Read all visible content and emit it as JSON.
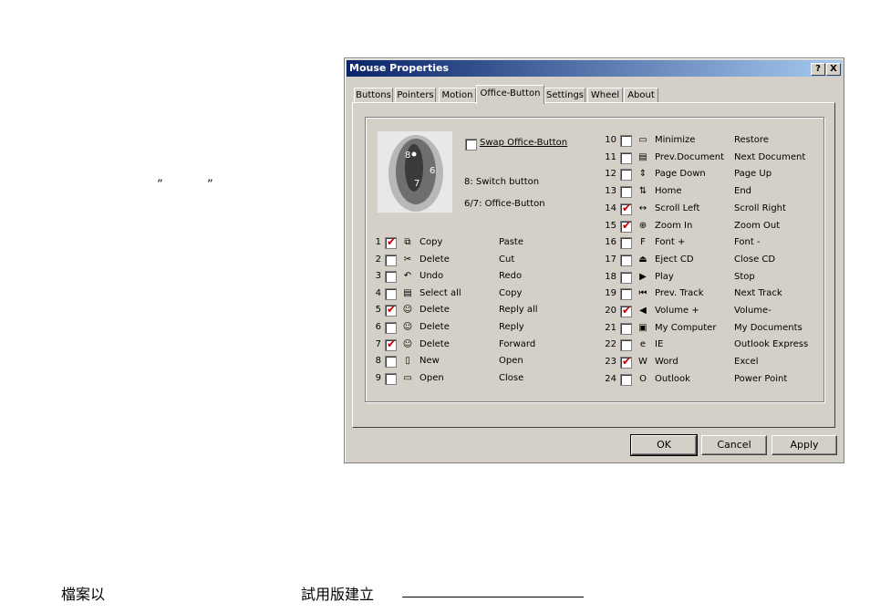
{
  "page": {
    "quote_open": "”",
    "quote_close": "”",
    "footer_left": "檔案以",
    "footer_right": "試用版建立"
  },
  "window": {
    "title": "Mouse Properties",
    "help_btn": "?",
    "close_btn": "X"
  },
  "tabs": [
    "Buttons",
    "Pointers",
    "Motion",
    "Office-Button",
    "Settings",
    "Wheel",
    "About"
  ],
  "swap_label": "Swap Office-Button",
  "info": [
    "8: Switch button",
    "6/7: Office-Button"
  ],
  "image_labels": [
    "8",
    "6",
    "7"
  ],
  "left_rows": [
    {
      "num": "1",
      "checked": true,
      "icon": "copy-icon",
      "glyph": "⧉",
      "action": "Copy",
      "alt": "Paste"
    },
    {
      "num": "2",
      "checked": false,
      "icon": "scissors-icon",
      "glyph": "✂",
      "action": "Delete",
      "alt": "Cut"
    },
    {
      "num": "3",
      "checked": false,
      "icon": "undo-icon",
      "glyph": "↶",
      "action": "Undo",
      "alt": "Redo"
    },
    {
      "num": "4",
      "checked": false,
      "icon": "select-all-icon",
      "glyph": "▤",
      "action": "Select all",
      "alt": "Copy"
    },
    {
      "num": "5",
      "checked": true,
      "icon": "mail-people-icon",
      "glyph": "☺",
      "action": "Delete",
      "alt": "Reply all"
    },
    {
      "num": "6",
      "checked": false,
      "icon": "mail-person-icon",
      "glyph": "☺",
      "action": "Delete",
      "alt": "Reply"
    },
    {
      "num": "7",
      "checked": true,
      "icon": "mail-forward-icon",
      "glyph": "☺",
      "action": "Delete",
      "alt": "Forward"
    },
    {
      "num": "8",
      "checked": false,
      "icon": "new-document-icon",
      "glyph": "▯",
      "action": "New",
      "alt": "Open"
    },
    {
      "num": "9",
      "checked": false,
      "icon": "open-folder-icon",
      "glyph": "▭",
      "action": "Open",
      "alt": "Close"
    }
  ],
  "right_rows": [
    {
      "num": "10",
      "checked": false,
      "icon": "minimize-icon",
      "glyph": "▭",
      "action": "Minimize",
      "alt": "Restore"
    },
    {
      "num": "11",
      "checked": false,
      "icon": "document-icon",
      "glyph": "▤",
      "action": "Prev.Document",
      "alt": "Next Document"
    },
    {
      "num": "12",
      "checked": false,
      "icon": "page-icon",
      "glyph": "⇕",
      "action": "Page Down",
      "alt": "Page Up"
    },
    {
      "num": "13",
      "checked": false,
      "icon": "home-end-icon",
      "glyph": "⇅",
      "action": "Home",
      "alt": "End"
    },
    {
      "num": "14",
      "checked": true,
      "icon": "scroll-icon",
      "glyph": "↔",
      "action": "Scroll Left",
      "alt": "Scroll Right"
    },
    {
      "num": "15",
      "checked": true,
      "icon": "zoom-icon",
      "glyph": "⊕",
      "action": "Zoom In",
      "alt": "Zoom Out"
    },
    {
      "num": "16",
      "checked": false,
      "icon": "font-icon",
      "glyph": "F",
      "action": "Font +",
      "alt": "Font -"
    },
    {
      "num": "17",
      "checked": false,
      "icon": "eject-icon",
      "glyph": "⏏",
      "action": "Eject CD",
      "alt": "Close CD"
    },
    {
      "num": "18",
      "checked": false,
      "icon": "play-pause-icon",
      "glyph": "▶",
      "action": "Play",
      "alt": "Stop"
    },
    {
      "num": "19",
      "checked": false,
      "icon": "track-icon",
      "glyph": "⏮",
      "action": "Prev. Track",
      "alt": "Next Track"
    },
    {
      "num": "20",
      "checked": true,
      "icon": "volume-icon",
      "glyph": "◀",
      "action": "Volume +",
      "alt": "Volume-"
    },
    {
      "num": "21",
      "checked": false,
      "icon": "computer-icon",
      "glyph": "▣",
      "action": "My Computer",
      "alt": "My Documents"
    },
    {
      "num": "22",
      "checked": false,
      "icon": "ie-icon",
      "glyph": "e",
      "action": "IE",
      "alt": "Outlook Express"
    },
    {
      "num": "23",
      "checked": true,
      "icon": "word-icon",
      "glyph": "W",
      "action": "Word",
      "alt": "Excel"
    },
    {
      "num": "24",
      "checked": false,
      "icon": "outlook-icon",
      "glyph": "O",
      "action": "Outlook",
      "alt": "Power Point"
    }
  ],
  "buttons": {
    "ok": "OK",
    "cancel": "Cancel",
    "apply": "Apply"
  }
}
